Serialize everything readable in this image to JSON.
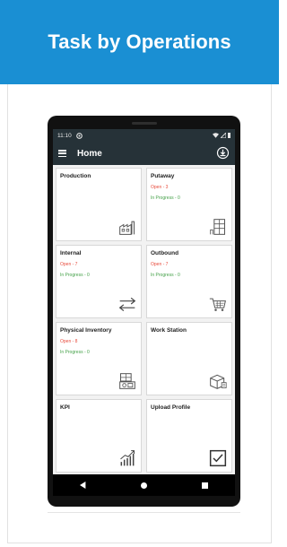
{
  "banner": {
    "title": "Task by Operations"
  },
  "status_bar": {
    "time": "11:10"
  },
  "app_bar": {
    "title": "Home"
  },
  "tiles": [
    {
      "title": "Production"
    },
    {
      "title": "Putaway",
      "open": "Open - 3",
      "in_progress": "In Progress - 0"
    },
    {
      "title": "Internal",
      "open": "Open - 7",
      "in_progress": "In Progress - 0"
    },
    {
      "title": "Outbound",
      "open": "Open - 7",
      "in_progress": "In Progress - 0"
    },
    {
      "title": "Physical Inventory",
      "open": "Open - 8",
      "in_progress": "In Progress - 0"
    },
    {
      "title": "Work Station"
    },
    {
      "title": "KPI"
    },
    {
      "title": "Upload Profile"
    }
  ],
  "colors": {
    "banner": "#1a8fd3",
    "app_bar": "#263238",
    "open_text": "#e84c3d",
    "in_progress_text": "#43a047"
  },
  "icons": [
    "hamburger-icon",
    "upload-icon",
    "factory-icon",
    "shelf-icon",
    "swap-arrows-icon",
    "cart-icon",
    "inventory-icon",
    "workstation-icon",
    "growth-chart-icon",
    "checkbox-icon",
    "back-icon",
    "home-icon",
    "recents-icon"
  ]
}
